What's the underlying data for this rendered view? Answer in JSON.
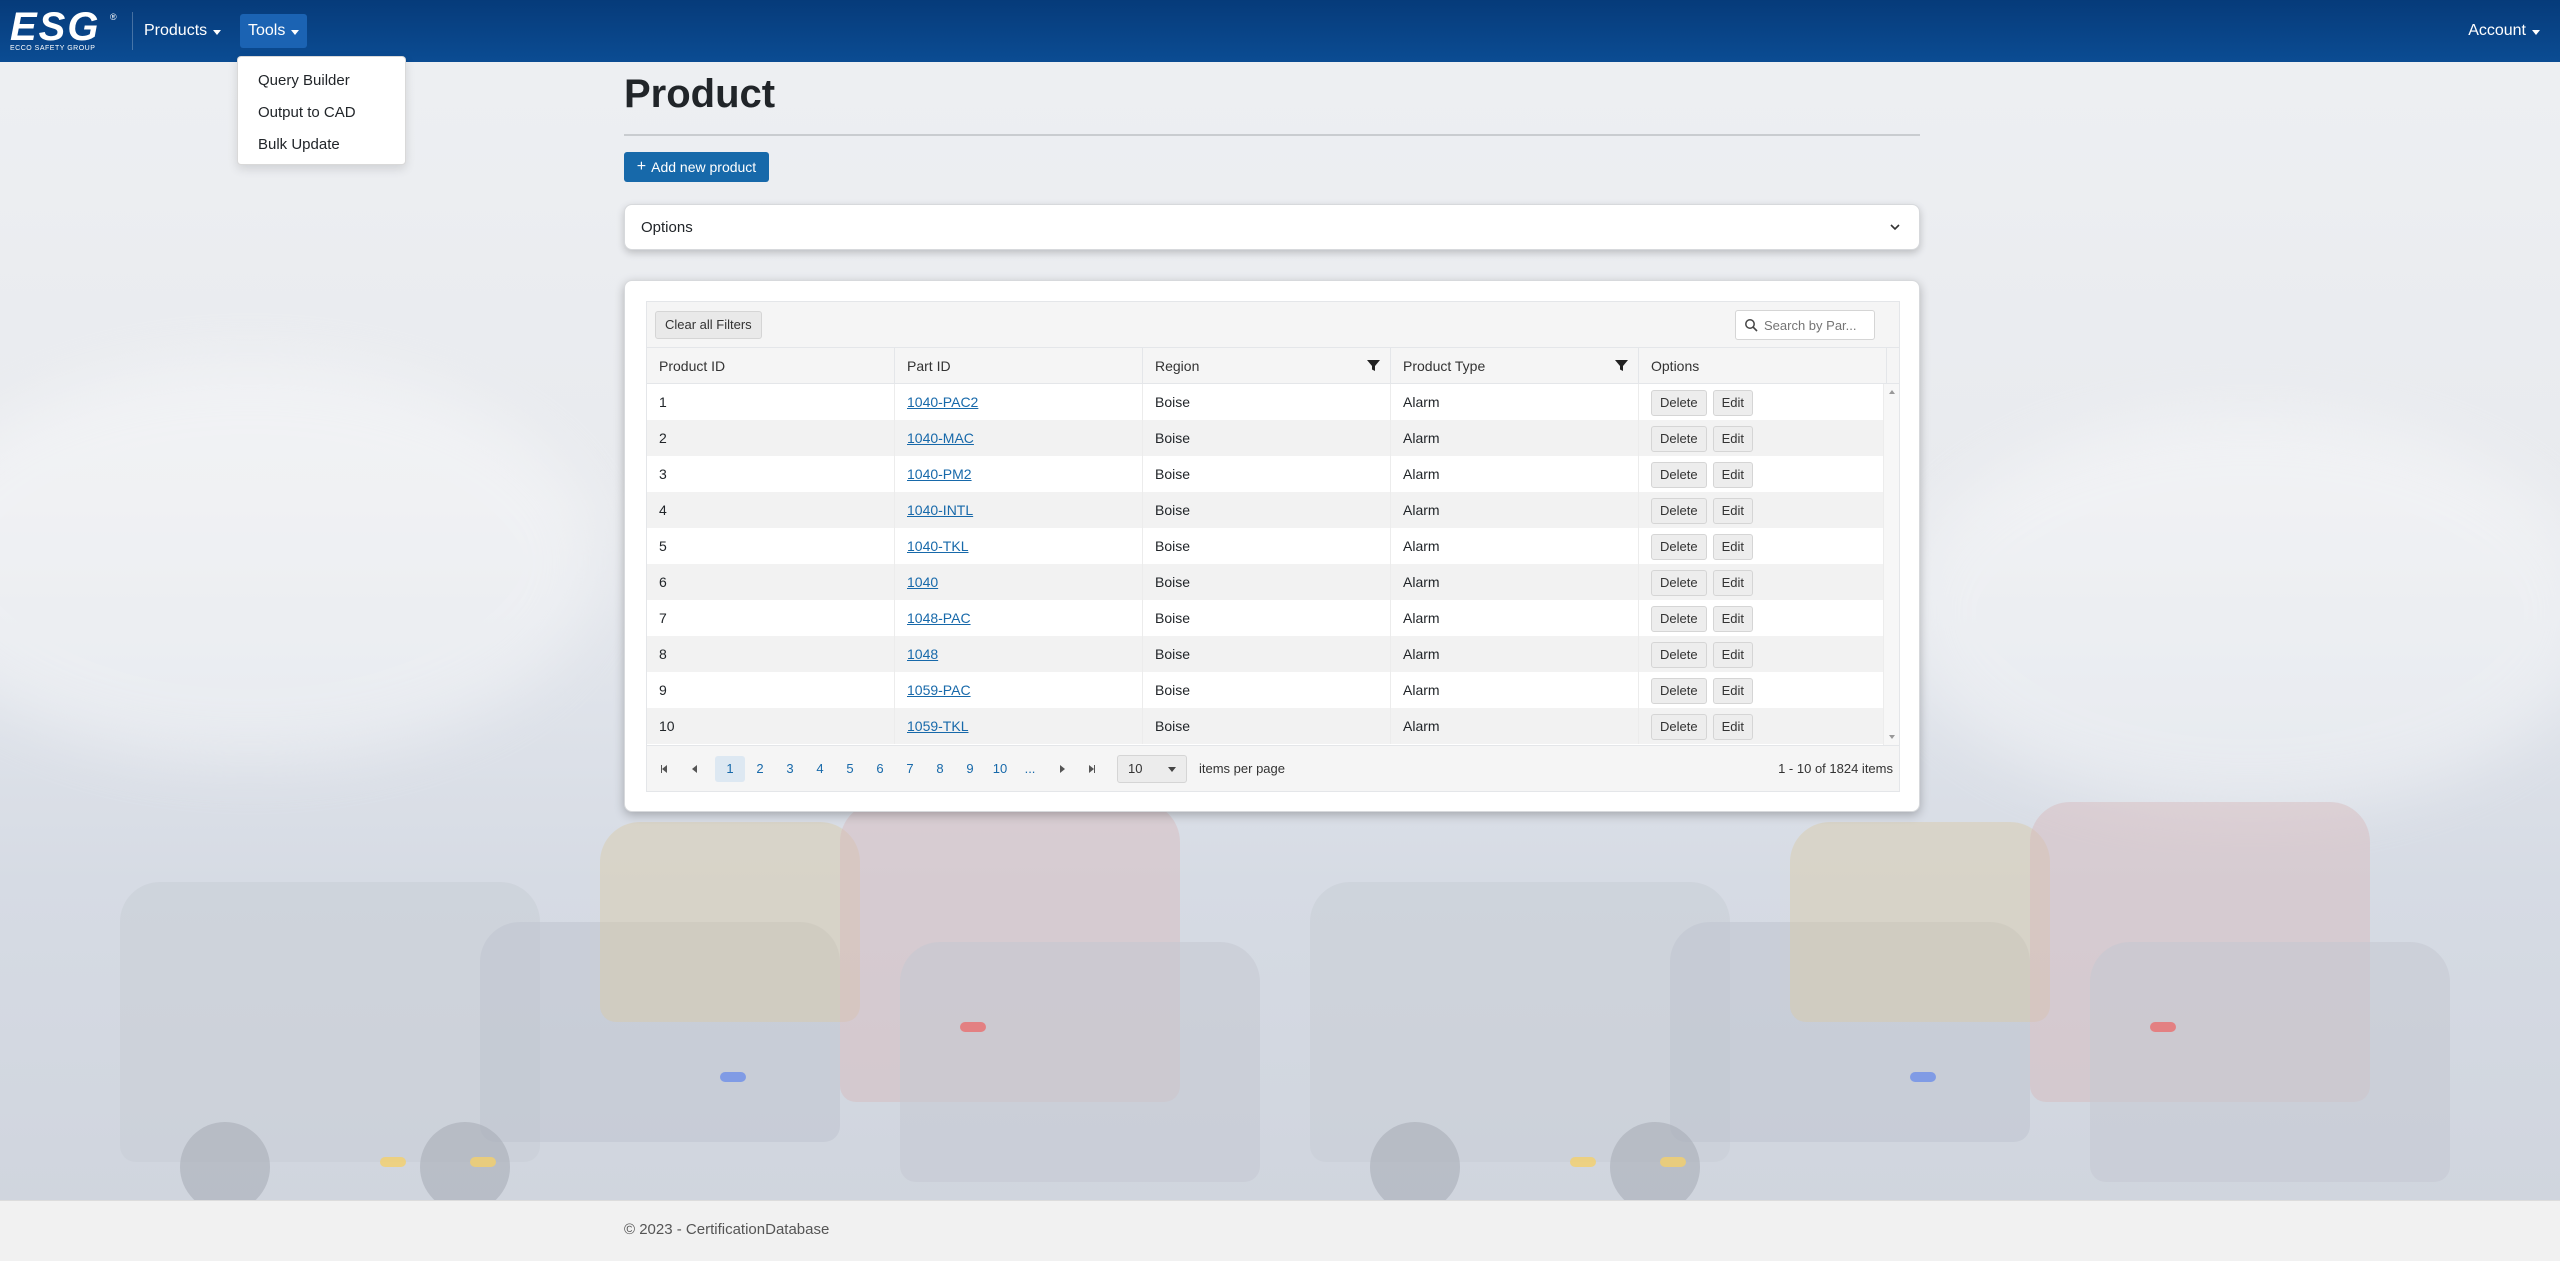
{
  "brand": {
    "logo_text": "ESG",
    "tagline": "ECCO SAFETY GROUP",
    "registered": "®"
  },
  "nav": {
    "products_label": "Products",
    "tools_label": "Tools",
    "account_label": "Account"
  },
  "tools_menu": [
    "Query Builder",
    "Output to CAD",
    "Bulk Update"
  ],
  "page": {
    "title": "Product",
    "add_button_label": "Add new product",
    "add_button_icon": "plus-icon",
    "options_label": "Options"
  },
  "grid": {
    "clear_filters_label": "Clear all Filters",
    "search_placeholder": "Search by Par...",
    "columns": [
      "Product ID",
      "Part ID",
      "Region",
      "Product Type",
      "Options"
    ],
    "delete_label": "Delete",
    "edit_label": "Edit",
    "rows": [
      {
        "id": "1",
        "part": "1040-PAC2",
        "region": "Boise",
        "type": "Alarm"
      },
      {
        "id": "2",
        "part": "1040-MAC",
        "region": "Boise",
        "type": "Alarm"
      },
      {
        "id": "3",
        "part": "1040-PM2",
        "region": "Boise",
        "type": "Alarm"
      },
      {
        "id": "4",
        "part": "1040-INTL",
        "region": "Boise",
        "type": "Alarm"
      },
      {
        "id": "5",
        "part": "1040-TKL",
        "region": "Boise",
        "type": "Alarm"
      },
      {
        "id": "6",
        "part": "1040",
        "region": "Boise",
        "type": "Alarm"
      },
      {
        "id": "7",
        "part": "1048-PAC",
        "region": "Boise",
        "type": "Alarm"
      },
      {
        "id": "8",
        "part": "1048",
        "region": "Boise",
        "type": "Alarm"
      },
      {
        "id": "9",
        "part": "1059-PAC",
        "region": "Boise",
        "type": "Alarm"
      },
      {
        "id": "10",
        "part": "1059-TKL",
        "region": "Boise",
        "type": "Alarm"
      }
    ],
    "pages": [
      "1",
      "2",
      "3",
      "4",
      "5",
      "6",
      "7",
      "8",
      "9",
      "10",
      "..."
    ],
    "current_page": "1",
    "per_page_value": "10",
    "per_page_label": "items per page",
    "info": "1 - 10 of 1824 items"
  },
  "footer": {
    "text": "© 2023 - CertificationDatabase"
  },
  "colors": {
    "navbar": "#0b4c93",
    "primary": "#1769aa",
    "link": "#1769aa"
  }
}
